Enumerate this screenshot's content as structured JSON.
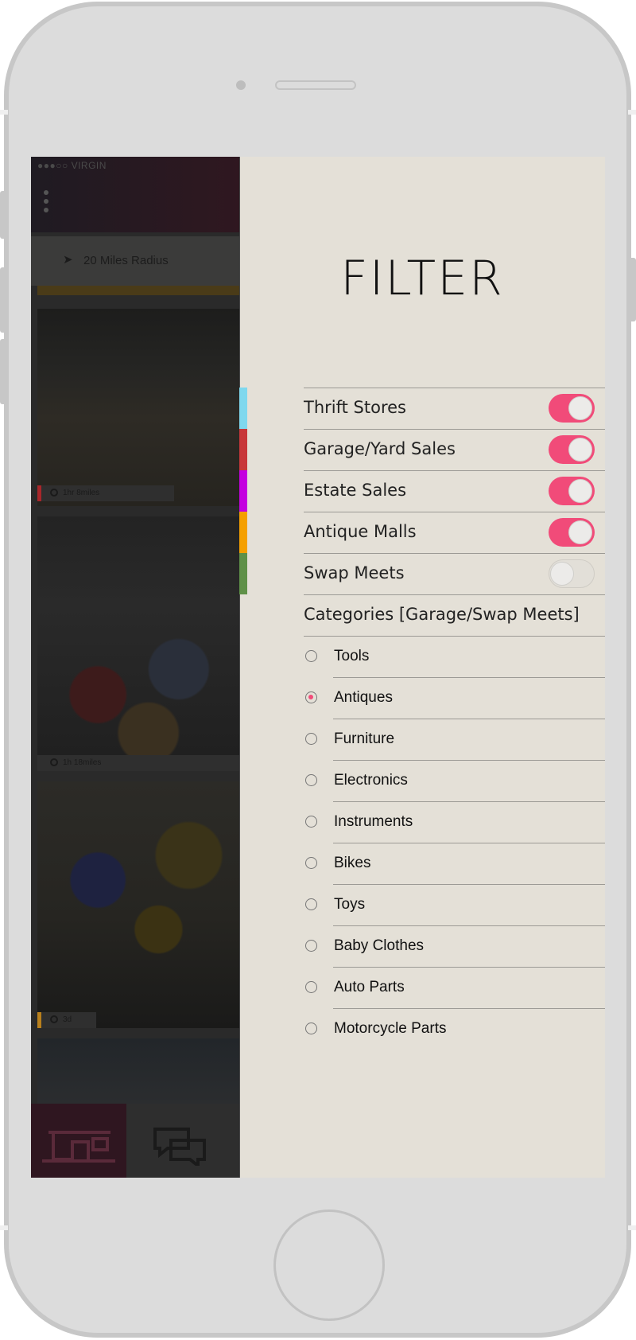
{
  "status_bar": {
    "carrier": "●●●○○ VIRGIN"
  },
  "background_app": {
    "radius_label": "20 Miles Radius",
    "cards": [
      {
        "meta": "1hr  8miles",
        "accent": "#a8262a"
      },
      {
        "meta": "1h  18miles",
        "accent": "#2f2f2f"
      },
      {
        "meta": "3d",
        "accent": "#b9801c"
      }
    ],
    "tabs": [
      "home-store-icon",
      "chat-bubbles-icon"
    ]
  },
  "filter": {
    "title": "FILTER",
    "toggles": [
      {
        "label": "Thrift Stores",
        "on": true,
        "color": "#7fd8ee"
      },
      {
        "label": "Garage/Yard Sales",
        "on": true,
        "color": "#c8373a"
      },
      {
        "label": "Estate Sales",
        "on": true,
        "color": "#c400e0"
      },
      {
        "label": "Antique Malls",
        "on": true,
        "color": "#f5a000"
      },
      {
        "label": "Swap Meets",
        "on": false,
        "color": "#5f9148"
      }
    ],
    "categories_header": "Categories [Garage/Swap Meets]",
    "categories": [
      {
        "label": "Tools",
        "selected": false
      },
      {
        "label": "Antiques",
        "selected": true
      },
      {
        "label": "Furniture",
        "selected": false
      },
      {
        "label": "Electronics",
        "selected": false
      },
      {
        "label": "Instruments",
        "selected": false
      },
      {
        "label": "Bikes",
        "selected": false
      },
      {
        "label": "Toys",
        "selected": false
      },
      {
        "label": "Baby Clothes",
        "selected": false
      },
      {
        "label": "Auto Parts",
        "selected": false
      },
      {
        "label": "Motorcycle Parts",
        "selected": false
      }
    ]
  },
  "colors": {
    "accent": "#f14b79",
    "panel": "#e4e0d7"
  }
}
